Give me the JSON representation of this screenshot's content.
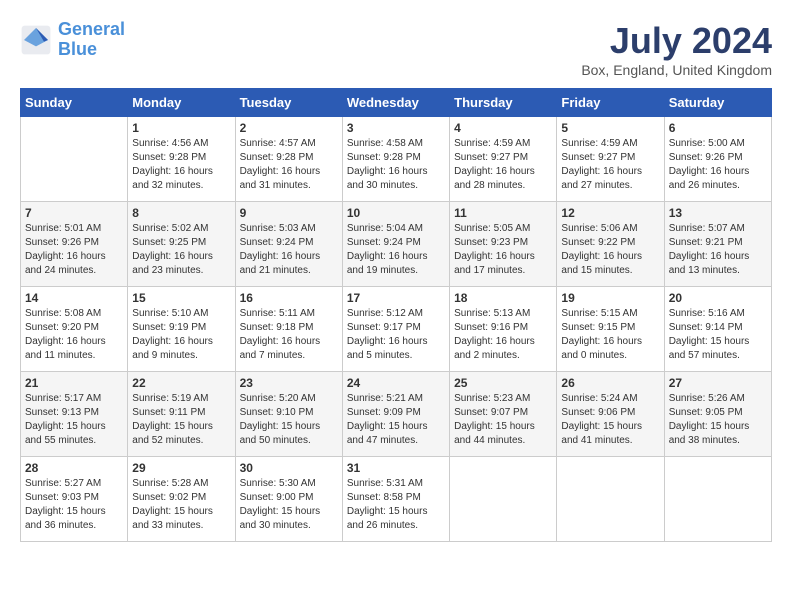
{
  "header": {
    "logo_line1": "General",
    "logo_line2": "Blue",
    "month_title": "July 2024",
    "location": "Box, England, United Kingdom"
  },
  "days_header": [
    "Sunday",
    "Monday",
    "Tuesday",
    "Wednesday",
    "Thursday",
    "Friday",
    "Saturday"
  ],
  "weeks": [
    [
      {
        "day": "",
        "info": ""
      },
      {
        "day": "1",
        "info": "Sunrise: 4:56 AM\nSunset: 9:28 PM\nDaylight: 16 hours\nand 32 minutes."
      },
      {
        "day": "2",
        "info": "Sunrise: 4:57 AM\nSunset: 9:28 PM\nDaylight: 16 hours\nand 31 minutes."
      },
      {
        "day": "3",
        "info": "Sunrise: 4:58 AM\nSunset: 9:28 PM\nDaylight: 16 hours\nand 30 minutes."
      },
      {
        "day": "4",
        "info": "Sunrise: 4:59 AM\nSunset: 9:27 PM\nDaylight: 16 hours\nand 28 minutes."
      },
      {
        "day": "5",
        "info": "Sunrise: 4:59 AM\nSunset: 9:27 PM\nDaylight: 16 hours\nand 27 minutes."
      },
      {
        "day": "6",
        "info": "Sunrise: 5:00 AM\nSunset: 9:26 PM\nDaylight: 16 hours\nand 26 minutes."
      }
    ],
    [
      {
        "day": "7",
        "info": "Sunrise: 5:01 AM\nSunset: 9:26 PM\nDaylight: 16 hours\nand 24 minutes."
      },
      {
        "day": "8",
        "info": "Sunrise: 5:02 AM\nSunset: 9:25 PM\nDaylight: 16 hours\nand 23 minutes."
      },
      {
        "day": "9",
        "info": "Sunrise: 5:03 AM\nSunset: 9:24 PM\nDaylight: 16 hours\nand 21 minutes."
      },
      {
        "day": "10",
        "info": "Sunrise: 5:04 AM\nSunset: 9:24 PM\nDaylight: 16 hours\nand 19 minutes."
      },
      {
        "day": "11",
        "info": "Sunrise: 5:05 AM\nSunset: 9:23 PM\nDaylight: 16 hours\nand 17 minutes."
      },
      {
        "day": "12",
        "info": "Sunrise: 5:06 AM\nSunset: 9:22 PM\nDaylight: 16 hours\nand 15 minutes."
      },
      {
        "day": "13",
        "info": "Sunrise: 5:07 AM\nSunset: 9:21 PM\nDaylight: 16 hours\nand 13 minutes."
      }
    ],
    [
      {
        "day": "14",
        "info": "Sunrise: 5:08 AM\nSunset: 9:20 PM\nDaylight: 16 hours\nand 11 minutes."
      },
      {
        "day": "15",
        "info": "Sunrise: 5:10 AM\nSunset: 9:19 PM\nDaylight: 16 hours\nand 9 minutes."
      },
      {
        "day": "16",
        "info": "Sunrise: 5:11 AM\nSunset: 9:18 PM\nDaylight: 16 hours\nand 7 minutes."
      },
      {
        "day": "17",
        "info": "Sunrise: 5:12 AM\nSunset: 9:17 PM\nDaylight: 16 hours\nand 5 minutes."
      },
      {
        "day": "18",
        "info": "Sunrise: 5:13 AM\nSunset: 9:16 PM\nDaylight: 16 hours\nand 2 minutes."
      },
      {
        "day": "19",
        "info": "Sunrise: 5:15 AM\nSunset: 9:15 PM\nDaylight: 16 hours\nand 0 minutes."
      },
      {
        "day": "20",
        "info": "Sunrise: 5:16 AM\nSunset: 9:14 PM\nDaylight: 15 hours\nand 57 minutes."
      }
    ],
    [
      {
        "day": "21",
        "info": "Sunrise: 5:17 AM\nSunset: 9:13 PM\nDaylight: 15 hours\nand 55 minutes."
      },
      {
        "day": "22",
        "info": "Sunrise: 5:19 AM\nSunset: 9:11 PM\nDaylight: 15 hours\nand 52 minutes."
      },
      {
        "day": "23",
        "info": "Sunrise: 5:20 AM\nSunset: 9:10 PM\nDaylight: 15 hours\nand 50 minutes."
      },
      {
        "day": "24",
        "info": "Sunrise: 5:21 AM\nSunset: 9:09 PM\nDaylight: 15 hours\nand 47 minutes."
      },
      {
        "day": "25",
        "info": "Sunrise: 5:23 AM\nSunset: 9:07 PM\nDaylight: 15 hours\nand 44 minutes."
      },
      {
        "day": "26",
        "info": "Sunrise: 5:24 AM\nSunset: 9:06 PM\nDaylight: 15 hours\nand 41 minutes."
      },
      {
        "day": "27",
        "info": "Sunrise: 5:26 AM\nSunset: 9:05 PM\nDaylight: 15 hours\nand 38 minutes."
      }
    ],
    [
      {
        "day": "28",
        "info": "Sunrise: 5:27 AM\nSunset: 9:03 PM\nDaylight: 15 hours\nand 36 minutes."
      },
      {
        "day": "29",
        "info": "Sunrise: 5:28 AM\nSunset: 9:02 PM\nDaylight: 15 hours\nand 33 minutes."
      },
      {
        "day": "30",
        "info": "Sunrise: 5:30 AM\nSunset: 9:00 PM\nDaylight: 15 hours\nand 30 minutes."
      },
      {
        "day": "31",
        "info": "Sunrise: 5:31 AM\nSunset: 8:58 PM\nDaylight: 15 hours\nand 26 minutes."
      },
      {
        "day": "",
        "info": ""
      },
      {
        "day": "",
        "info": ""
      },
      {
        "day": "",
        "info": ""
      }
    ]
  ]
}
